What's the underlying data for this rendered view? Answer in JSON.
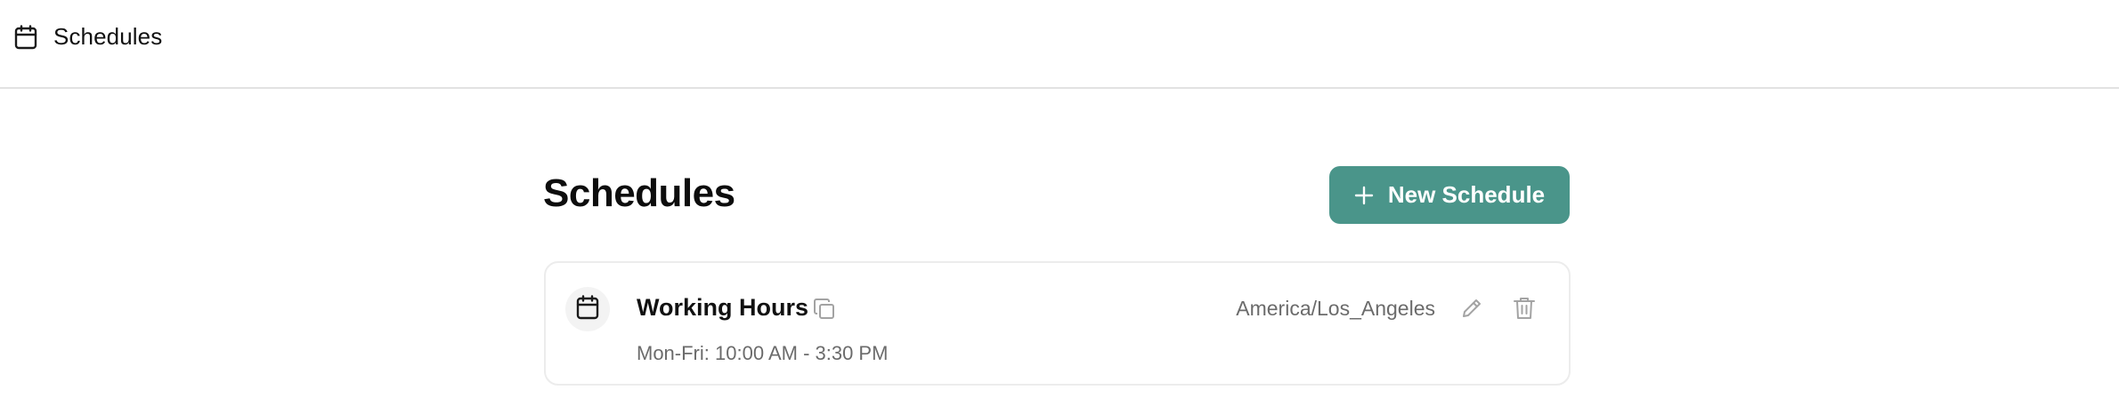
{
  "topbar": {
    "icon": "calendar-icon",
    "title": "Schedules"
  },
  "page": {
    "title": "Schedules",
    "new_button_label": "New Schedule",
    "new_button_icon": "plus-icon"
  },
  "schedules": [
    {
      "name": "Working Hours",
      "hours": "Mon-Fri: 10:00 AM - 3:30 PM",
      "timezone": "America/Los_Angeles",
      "icons": [
        "calendar-icon",
        "copy-icon",
        "pencil-icon",
        "trash-icon"
      ]
    }
  ],
  "colors": {
    "accent": "#4a958a",
    "muted_text": "#6b6b6b",
    "border": "#e2e2e2"
  }
}
